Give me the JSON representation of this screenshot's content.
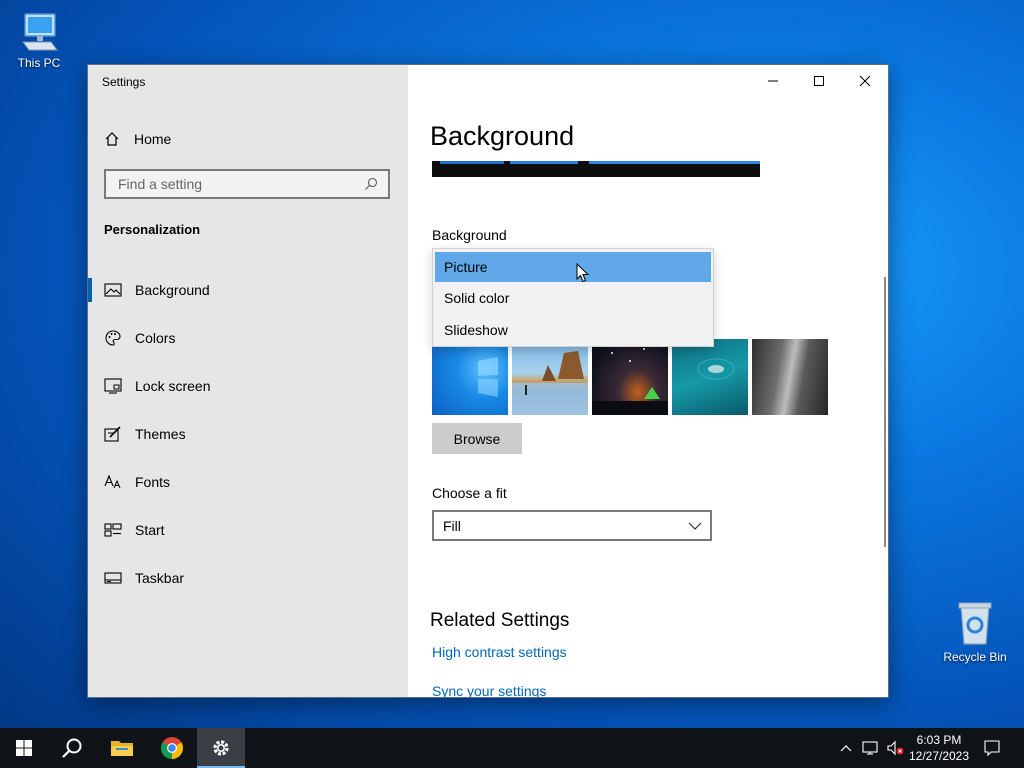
{
  "desktop": {
    "icons": [
      {
        "label": "This PC"
      },
      {
        "label": "Recycle Bin"
      }
    ]
  },
  "window": {
    "title": "Settings",
    "sidebar": {
      "home_label": "Home",
      "search_placeholder": "Find a setting",
      "section_title": "Personalization",
      "items": [
        {
          "label": "Background",
          "icon": "picture-icon",
          "active": true
        },
        {
          "label": "Colors",
          "icon": "palette-icon"
        },
        {
          "label": "Lock screen",
          "icon": "lock-screen-icon"
        },
        {
          "label": "Themes",
          "icon": "themes-brush-icon"
        },
        {
          "label": "Fonts",
          "icon": "fonts-icon"
        },
        {
          "label": "Start",
          "icon": "start-grid-icon"
        },
        {
          "label": "Taskbar",
          "icon": "taskbar-icon"
        }
      ]
    },
    "content": {
      "page_title": "Background",
      "background_label": "Background",
      "background_options": [
        "Picture",
        "Solid color",
        "Slideshow"
      ],
      "background_selected": "Picture",
      "browse_label": "Browse",
      "fit_label": "Choose a fit",
      "fit_value": "Fill",
      "related_title": "Related Settings",
      "links": [
        "High contrast settings",
        "Sync your settings"
      ]
    }
  },
  "taskbar": {
    "apps": [
      "start-icon",
      "search-icon",
      "file-explorer-icon",
      "chrome-icon",
      "settings-icon"
    ],
    "active_app": "settings-icon",
    "clock": {
      "time": "6:03 PM",
      "date": "12/27/2023"
    }
  },
  "colors": {
    "accent": "#0063b1",
    "link": "#0067b8",
    "selection": "#60a8e8",
    "sidebar_bg": "#e6e6e6"
  }
}
